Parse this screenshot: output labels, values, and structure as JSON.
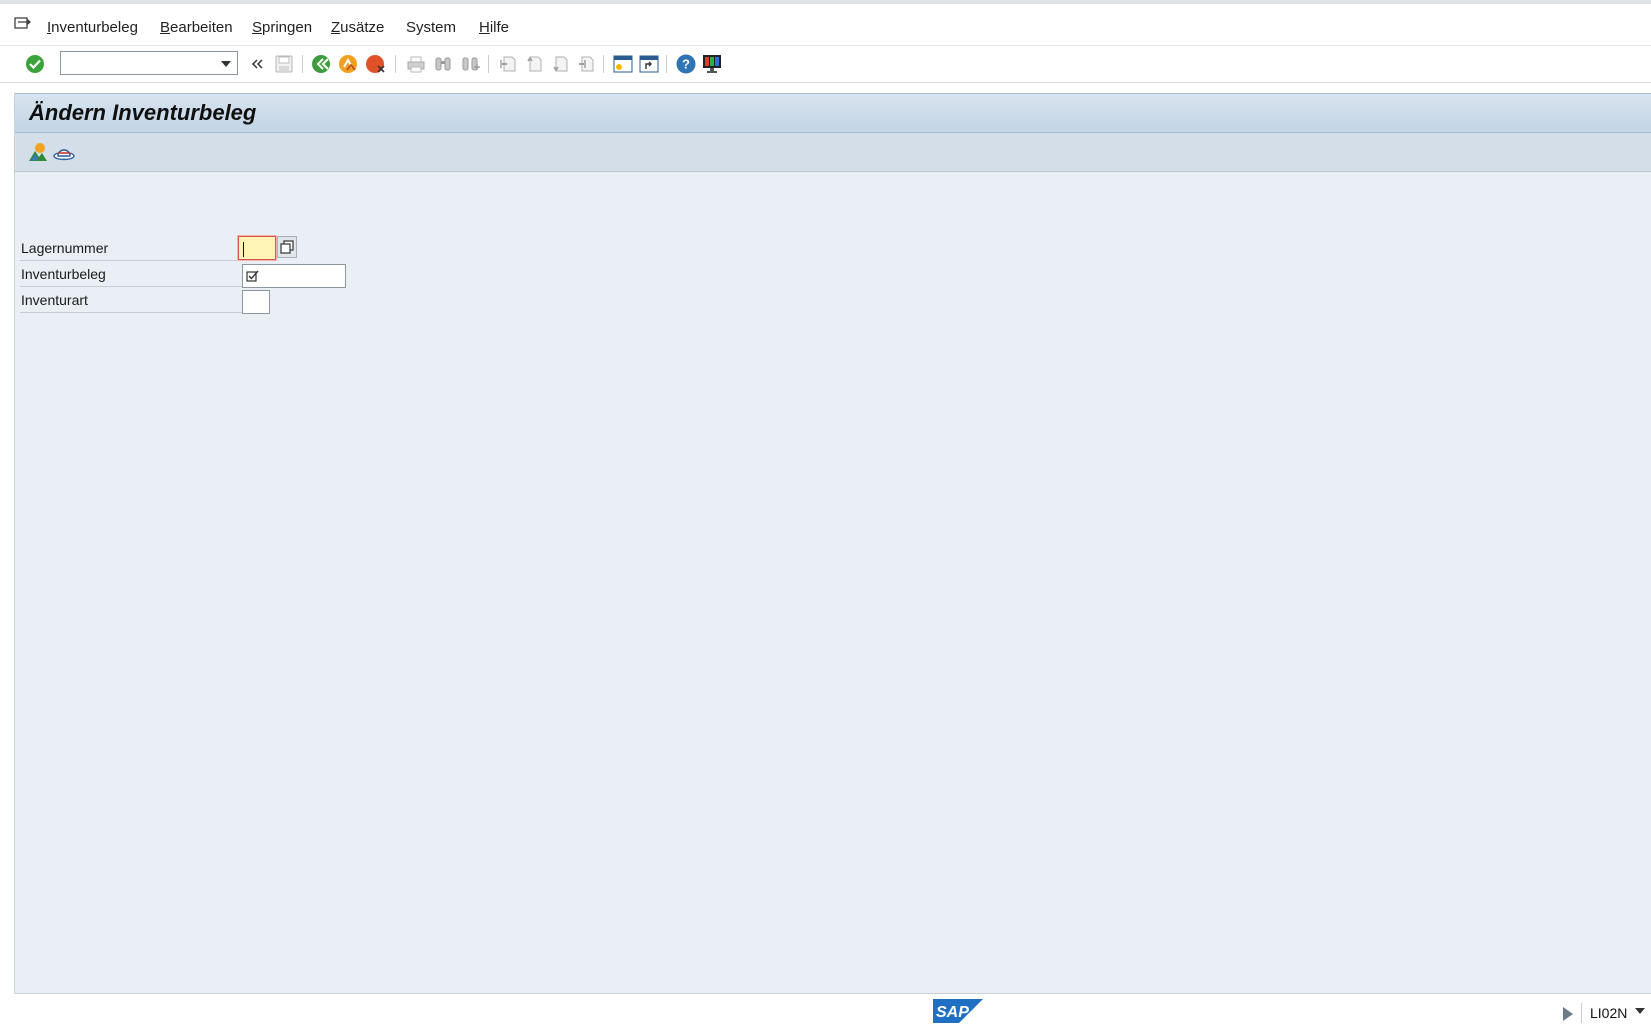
{
  "menubar": {
    "items": [
      {
        "label": "Inventurbeleg",
        "underline": "I",
        "rest": "nventurbeleg"
      },
      {
        "label": "Bearbeiten",
        "underline": "B",
        "rest": "earbeiten"
      },
      {
        "label": "Springen",
        "underline": "S",
        "rest": "pringen"
      },
      {
        "label": "Zusätze",
        "underline": "Z",
        "rest": "usätze"
      },
      {
        "label": "System",
        "underline": "",
        "rest": "System"
      },
      {
        "label": "Hilfe",
        "underline": "H",
        "rest": "ilfe"
      }
    ]
  },
  "toolbar": {
    "command_field_value": "",
    "icons": [
      "enter-icon",
      "command-field",
      "back-arrows-icon",
      "save-icon",
      "back-icon",
      "exit-icon",
      "cancel-icon",
      "print-icon",
      "find-icon",
      "find-next-icon",
      "first-page-icon",
      "previous-page-icon",
      "next-page-icon",
      "last-page-icon",
      "new-session-icon",
      "create-shortcut-icon",
      "help-icon",
      "customize-layout-icon"
    ]
  },
  "screen": {
    "title": "Ändern Inventurbeleg",
    "app_icons": [
      "display-change-icon",
      "hat-icon"
    ]
  },
  "form": {
    "fields": [
      {
        "label": "Lagernummer",
        "value": ""
      },
      {
        "label": "Inventurbeleg",
        "value": ""
      },
      {
        "label": "Inventurart",
        "value": ""
      }
    ]
  },
  "status": {
    "logo": "SAP",
    "transaction": "LI02N"
  },
  "colors": {
    "work_bg": "#e9eff5",
    "title_bg": "#c3d5e6",
    "active_field": "#fff3b5",
    "enter_green": "#3aa43a",
    "sap_blue": "#1f6fc5"
  }
}
